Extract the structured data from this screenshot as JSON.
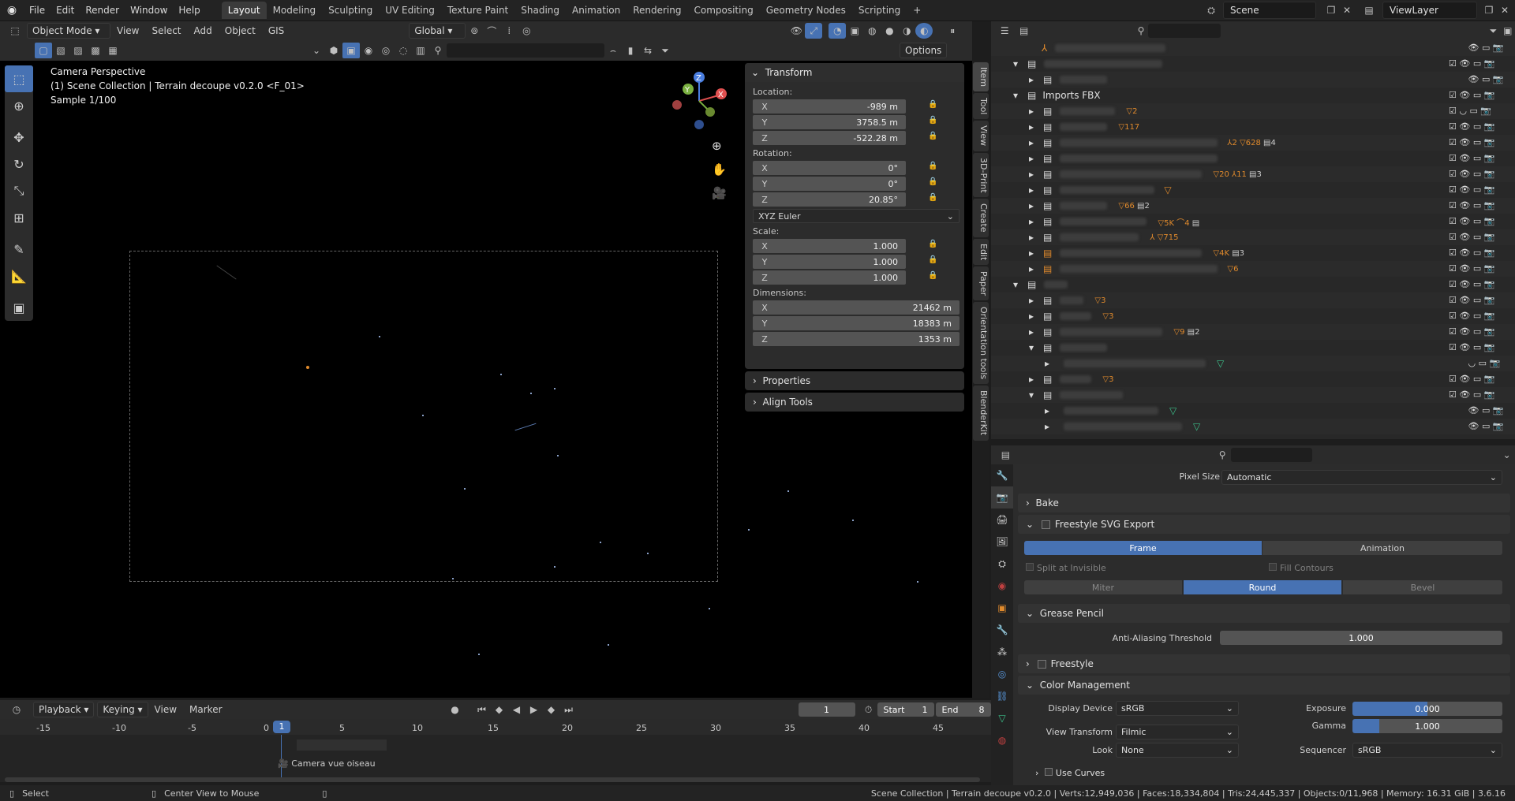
{
  "menu": {
    "file": "File",
    "edit": "Edit",
    "render": "Render",
    "window": "Window",
    "help": "Help"
  },
  "workspaces": [
    "Layout",
    "Modeling",
    "Sculpting",
    "UV Editing",
    "Texture Paint",
    "Shading",
    "Animation",
    "Rendering",
    "Compositing",
    "Geometry Nodes",
    "Scripting"
  ],
  "scene": "Scene",
  "view_layer": "ViewLayer",
  "viewport_header": {
    "mode": "Object Mode",
    "view": "View",
    "select": "Select",
    "add": "Add",
    "object": "Object",
    "gis": "GIS",
    "orientation": "Global",
    "options": "Options"
  },
  "overlay": {
    "line1": "Camera Perspective",
    "line2": "(1) Scene Collection | Terrain decoupe v0.2.0 <F_01>",
    "line3": "Sample 1/100"
  },
  "gizmo": {
    "x": "X",
    "y": "Y",
    "z": "Z"
  },
  "npanel": {
    "transform": "Transform",
    "location_label": "Location:",
    "location": [
      {
        "axis": "X",
        "value": "-989 m"
      },
      {
        "axis": "Y",
        "value": "3758.5 m"
      },
      {
        "axis": "Z",
        "value": "-522.28 m"
      }
    ],
    "rotation_label": "Rotation:",
    "rotation": [
      {
        "axis": "X",
        "value": "0°"
      },
      {
        "axis": "Y",
        "value": "0°"
      },
      {
        "axis": "Z",
        "value": "20.85°"
      }
    ],
    "rotation_mode": "XYZ Euler",
    "scale_label": "Scale:",
    "scale": [
      {
        "axis": "X",
        "value": "1.000"
      },
      {
        "axis": "Y",
        "value": "1.000"
      },
      {
        "axis": "Z",
        "value": "1.000"
      }
    ],
    "dimensions_label": "Dimensions:",
    "dimensions": [
      {
        "axis": "X",
        "value": "21462 m"
      },
      {
        "axis": "Y",
        "value": "18383 m"
      },
      {
        "axis": "Z",
        "value": "1353 m"
      }
    ],
    "properties": "Properties",
    "align_tools": "Align Tools"
  },
  "side_tabs": [
    "Item",
    "Tool",
    "View",
    "3D-Print",
    "Create",
    "Edit",
    "Paper",
    "Orientation tools",
    "BlenderKit"
  ],
  "outliner": {
    "imports_fbx": "Imports FBX",
    "counts": [
      "2",
      "117",
      "2",
      "628",
      "4",
      "20",
      "11",
      "3",
      "66",
      "2",
      "5K",
      "4",
      "715",
      "4K",
      "3",
      "6",
      "3",
      "3",
      "9",
      "2",
      "3"
    ]
  },
  "properties": {
    "pixel_size_label": "Pixel Size",
    "pixel_size": "Automatic",
    "bake": "Bake",
    "freestyle_svg": "Freestyle SVG Export",
    "frame": "Frame",
    "animation": "Animation",
    "split_invisible": "Split at Invisible",
    "fill_contours": "Fill Contours",
    "miter": "Miter",
    "round": "Round",
    "bevel": "Bevel",
    "grease_pencil": "Grease Pencil",
    "aa_threshold_label": "Anti-Aliasing Threshold",
    "aa_threshold": "1.000",
    "freestyle": "Freestyle",
    "color_management": "Color Management",
    "display_device_label": "Display Device",
    "display_device": "sRGB",
    "view_transform_label": "View Transform",
    "view_transform": "Filmic",
    "look_label": "Look",
    "look": "None",
    "exposure_label": "Exposure",
    "exposure": "0.000",
    "gamma_label": "Gamma",
    "gamma": "1.000",
    "sequencer_label": "Sequencer",
    "sequencer": "sRGB",
    "use_curves": "Use Curves"
  },
  "timeline": {
    "playback": "Playback",
    "keying": "Keying",
    "view": "View",
    "marker": "Marker",
    "current_frame": "1",
    "start_label": "Start",
    "start": "1",
    "end_label": "End",
    "end": "8",
    "ticks": [
      "-15",
      "-10",
      "-5",
      "0",
      "5",
      "10",
      "15",
      "20",
      "25",
      "30",
      "35",
      "40",
      "45"
    ],
    "marker_frame": "1",
    "camera_label": "Camera vue oiseau"
  },
  "statusbar": {
    "select": "Select",
    "center_view": "Center View to Mouse",
    "stats": "Scene Collection | Terrain decoupe v0.2.0 | Verts:12,949,036 | Faces:18,334,804 | Tris:24,445,337 | Objects:0/11,968 | Memory: 16.31 GiB | 3.6.16"
  },
  "colors": {
    "accent": "#4772b3",
    "orange": "#e08a2c",
    "outliner_green": "#3cc08a"
  }
}
